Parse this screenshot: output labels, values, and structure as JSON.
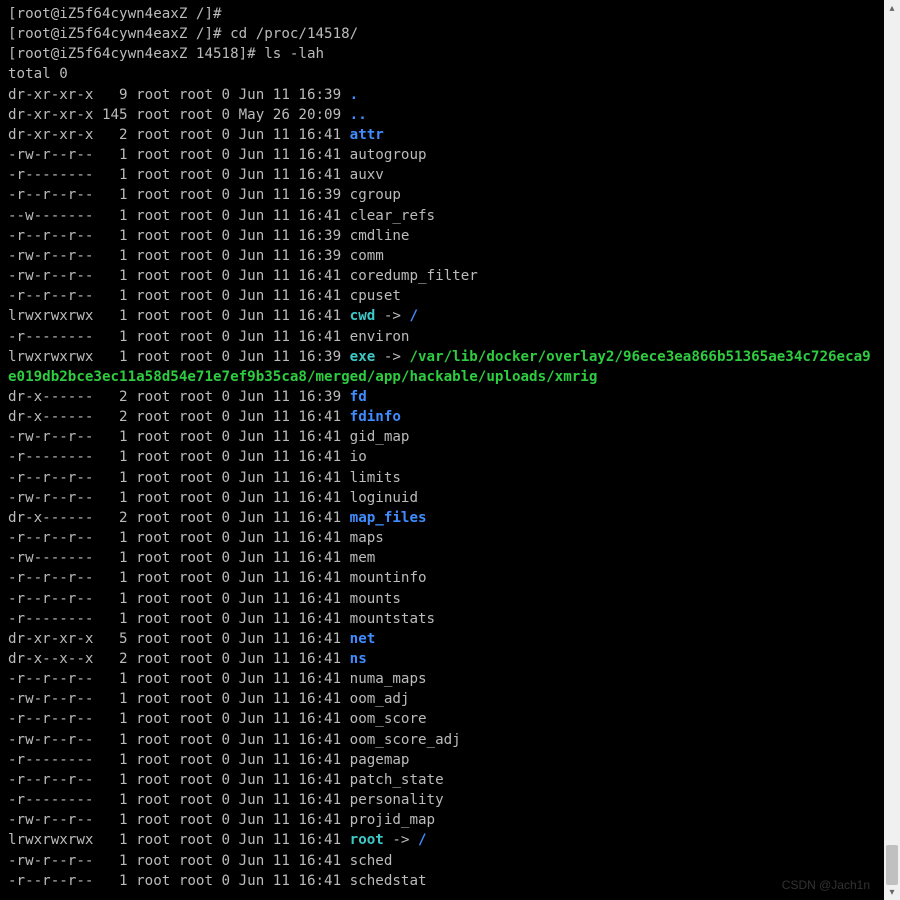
{
  "prompts": [
    {
      "user": "root",
      "host": "iZ5f64cywn4eaxZ",
      "cwd": "/",
      "cmd": ""
    },
    {
      "user": "root",
      "host": "iZ5f64cywn4eaxZ",
      "cwd": "/",
      "cmd": "cd /proc/14518/"
    },
    {
      "user": "root",
      "host": "iZ5f64cywn4eaxZ",
      "cwd": "14518",
      "cmd": "ls -lah"
    }
  ],
  "total": "total 0",
  "symlink_target_long": "/var/lib/docker/overlay2/96ece3ea866b51365ae34c726eca9e019db2bce3ec11a58d54e71e7ef9b35ca8/merged/app/hackable/uploads/xmrig",
  "entries": [
    {
      "perm": "dr-xr-xr-x",
      "links": "9",
      "owner": "root",
      "group": "root",
      "size": "0",
      "date": "Jun 11 16:39",
      "name": ".",
      "type": "dir"
    },
    {
      "perm": "dr-xr-xr-x",
      "links": "145",
      "owner": "root",
      "group": "root",
      "size": "0",
      "date": "May 26 20:09",
      "name": "..",
      "type": "dir"
    },
    {
      "perm": "dr-xr-xr-x",
      "links": "2",
      "owner": "root",
      "group": "root",
      "size": "0",
      "date": "Jun 11 16:41",
      "name": "attr",
      "type": "dir"
    },
    {
      "perm": "-rw-r--r--",
      "links": "1",
      "owner": "root",
      "group": "root",
      "size": "0",
      "date": "Jun 11 16:41",
      "name": "autogroup",
      "type": "file"
    },
    {
      "perm": "-r--------",
      "links": "1",
      "owner": "root",
      "group": "root",
      "size": "0",
      "date": "Jun 11 16:41",
      "name": "auxv",
      "type": "file"
    },
    {
      "perm": "-r--r--r--",
      "links": "1",
      "owner": "root",
      "group": "root",
      "size": "0",
      "date": "Jun 11 16:39",
      "name": "cgroup",
      "type": "file"
    },
    {
      "perm": "--w-------",
      "links": "1",
      "owner": "root",
      "group": "root",
      "size": "0",
      "date": "Jun 11 16:41",
      "name": "clear_refs",
      "type": "file"
    },
    {
      "perm": "-r--r--r--",
      "links": "1",
      "owner": "root",
      "group": "root",
      "size": "0",
      "date": "Jun 11 16:39",
      "name": "cmdline",
      "type": "file"
    },
    {
      "perm": "-rw-r--r--",
      "links": "1",
      "owner": "root",
      "group": "root",
      "size": "0",
      "date": "Jun 11 16:39",
      "name": "comm",
      "type": "file"
    },
    {
      "perm": "-rw-r--r--",
      "links": "1",
      "owner": "root",
      "group": "root",
      "size": "0",
      "date": "Jun 11 16:41",
      "name": "coredump_filter",
      "type": "file"
    },
    {
      "perm": "-r--r--r--",
      "links": "1",
      "owner": "root",
      "group": "root",
      "size": "0",
      "date": "Jun 11 16:41",
      "name": "cpuset",
      "type": "file"
    },
    {
      "perm": "lrwxrwxrwx",
      "links": "1",
      "owner": "root",
      "group": "root",
      "size": "0",
      "date": "Jun 11 16:41",
      "name": "cwd",
      "type": "symlink",
      "target": "/",
      "target_type": "dir"
    },
    {
      "perm": "-r--------",
      "links": "1",
      "owner": "root",
      "group": "root",
      "size": "0",
      "date": "Jun 11 16:41",
      "name": "environ",
      "type": "file"
    },
    {
      "perm": "lrwxrwxrwx",
      "links": "1",
      "owner": "root",
      "group": "root",
      "size": "0",
      "date": "Jun 11 16:39",
      "name": "exe",
      "type": "symlink",
      "target": "LONG",
      "target_type": "exe"
    },
    {
      "perm": "dr-x------",
      "links": "2",
      "owner": "root",
      "group": "root",
      "size": "0",
      "date": "Jun 11 16:39",
      "name": "fd",
      "type": "dir"
    },
    {
      "perm": "dr-x------",
      "links": "2",
      "owner": "root",
      "group": "root",
      "size": "0",
      "date": "Jun 11 16:41",
      "name": "fdinfo",
      "type": "dir"
    },
    {
      "perm": "-rw-r--r--",
      "links": "1",
      "owner": "root",
      "group": "root",
      "size": "0",
      "date": "Jun 11 16:41",
      "name": "gid_map",
      "type": "file"
    },
    {
      "perm": "-r--------",
      "links": "1",
      "owner": "root",
      "group": "root",
      "size": "0",
      "date": "Jun 11 16:41",
      "name": "io",
      "type": "file"
    },
    {
      "perm": "-r--r--r--",
      "links": "1",
      "owner": "root",
      "group": "root",
      "size": "0",
      "date": "Jun 11 16:41",
      "name": "limits",
      "type": "file"
    },
    {
      "perm": "-rw-r--r--",
      "links": "1",
      "owner": "root",
      "group": "root",
      "size": "0",
      "date": "Jun 11 16:41",
      "name": "loginuid",
      "type": "file"
    },
    {
      "perm": "dr-x------",
      "links": "2",
      "owner": "root",
      "group": "root",
      "size": "0",
      "date": "Jun 11 16:41",
      "name": "map_files",
      "type": "dir"
    },
    {
      "perm": "-r--r--r--",
      "links": "1",
      "owner": "root",
      "group": "root",
      "size": "0",
      "date": "Jun 11 16:41",
      "name": "maps",
      "type": "file"
    },
    {
      "perm": "-rw-------",
      "links": "1",
      "owner": "root",
      "group": "root",
      "size": "0",
      "date": "Jun 11 16:41",
      "name": "mem",
      "type": "file"
    },
    {
      "perm": "-r--r--r--",
      "links": "1",
      "owner": "root",
      "group": "root",
      "size": "0",
      "date": "Jun 11 16:41",
      "name": "mountinfo",
      "type": "file"
    },
    {
      "perm": "-r--r--r--",
      "links": "1",
      "owner": "root",
      "group": "root",
      "size": "0",
      "date": "Jun 11 16:41",
      "name": "mounts",
      "type": "file"
    },
    {
      "perm": "-r--------",
      "links": "1",
      "owner": "root",
      "group": "root",
      "size": "0",
      "date": "Jun 11 16:41",
      "name": "mountstats",
      "type": "file"
    },
    {
      "perm": "dr-xr-xr-x",
      "links": "5",
      "owner": "root",
      "group": "root",
      "size": "0",
      "date": "Jun 11 16:41",
      "name": "net",
      "type": "dir"
    },
    {
      "perm": "dr-x--x--x",
      "links": "2",
      "owner": "root",
      "group": "root",
      "size": "0",
      "date": "Jun 11 16:41",
      "name": "ns",
      "type": "dir"
    },
    {
      "perm": "-r--r--r--",
      "links": "1",
      "owner": "root",
      "group": "root",
      "size": "0",
      "date": "Jun 11 16:41",
      "name": "numa_maps",
      "type": "file"
    },
    {
      "perm": "-rw-r--r--",
      "links": "1",
      "owner": "root",
      "group": "root",
      "size": "0",
      "date": "Jun 11 16:41",
      "name": "oom_adj",
      "type": "file"
    },
    {
      "perm": "-r--r--r--",
      "links": "1",
      "owner": "root",
      "group": "root",
      "size": "0",
      "date": "Jun 11 16:41",
      "name": "oom_score",
      "type": "file"
    },
    {
      "perm": "-rw-r--r--",
      "links": "1",
      "owner": "root",
      "group": "root",
      "size": "0",
      "date": "Jun 11 16:41",
      "name": "oom_score_adj",
      "type": "file"
    },
    {
      "perm": "-r--------",
      "links": "1",
      "owner": "root",
      "group": "root",
      "size": "0",
      "date": "Jun 11 16:41",
      "name": "pagemap",
      "type": "file"
    },
    {
      "perm": "-r--r--r--",
      "links": "1",
      "owner": "root",
      "group": "root",
      "size": "0",
      "date": "Jun 11 16:41",
      "name": "patch_state",
      "type": "file"
    },
    {
      "perm": "-r--------",
      "links": "1",
      "owner": "root",
      "group": "root",
      "size": "0",
      "date": "Jun 11 16:41",
      "name": "personality",
      "type": "file"
    },
    {
      "perm": "-rw-r--r--",
      "links": "1",
      "owner": "root",
      "group": "root",
      "size": "0",
      "date": "Jun 11 16:41",
      "name": "projid_map",
      "type": "file"
    },
    {
      "perm": "lrwxrwxrwx",
      "links": "1",
      "owner": "root",
      "group": "root",
      "size": "0",
      "date": "Jun 11 16:41",
      "name": "root",
      "type": "symlink",
      "target": "/",
      "target_type": "dir"
    },
    {
      "perm": "-rw-r--r--",
      "links": "1",
      "owner": "root",
      "group": "root",
      "size": "0",
      "date": "Jun 11 16:41",
      "name": "sched",
      "type": "file"
    },
    {
      "perm": "-r--r--r--",
      "links": "1",
      "owner": "root",
      "group": "root",
      "size": "0",
      "date": "Jun 11 16:41",
      "name": "schedstat",
      "type": "file"
    }
  ],
  "watermark": "CSDN @Jach1n"
}
